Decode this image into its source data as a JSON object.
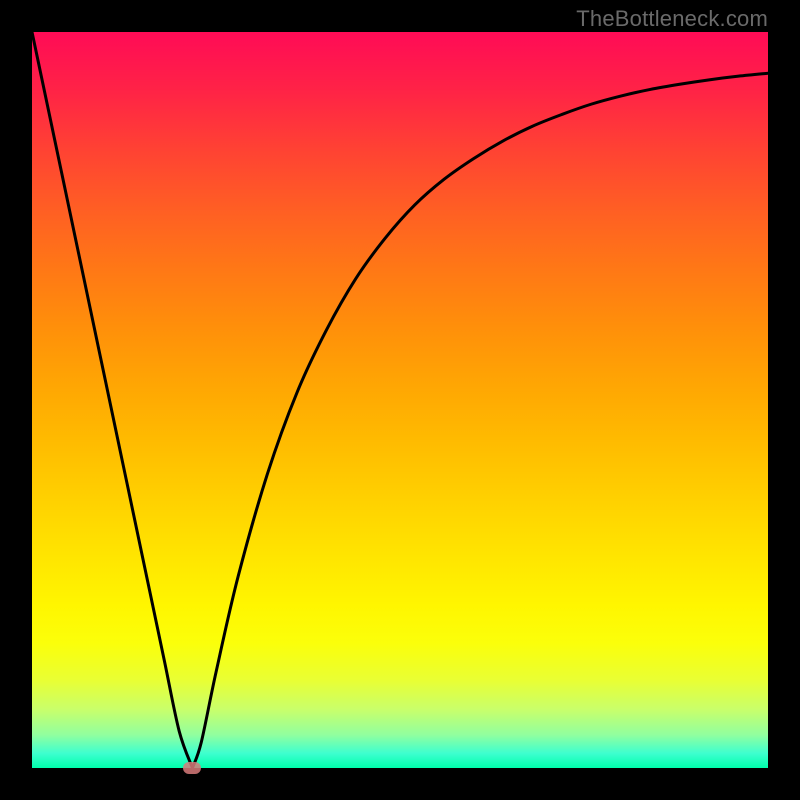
{
  "watermark": "TheBottleneck.com",
  "chart_data": {
    "type": "line",
    "title": "",
    "xlabel": "",
    "ylabel": "",
    "xlim": [
      0,
      1
    ],
    "ylim": [
      0,
      1
    ],
    "grid": false,
    "legend": false,
    "series": [
      {
        "name": "bottleneck-curve",
        "color": "#000000",
        "x": [
          0.0,
          0.02,
          0.04,
          0.06,
          0.08,
          0.1,
          0.12,
          0.14,
          0.16,
          0.18,
          0.2,
          0.218,
          0.23,
          0.25,
          0.28,
          0.32,
          0.36,
          0.4,
          0.44,
          0.48,
          0.52,
          0.56,
          0.6,
          0.64,
          0.68,
          0.72,
          0.76,
          0.8,
          0.84,
          0.88,
          0.92,
          0.96,
          1.0
        ],
        "y": [
          1.0,
          0.905,
          0.81,
          0.715,
          0.62,
          0.525,
          0.43,
          0.335,
          0.24,
          0.145,
          0.05,
          0.0,
          0.035,
          0.13,
          0.26,
          0.4,
          0.51,
          0.595,
          0.665,
          0.72,
          0.765,
          0.8,
          0.828,
          0.852,
          0.872,
          0.888,
          0.902,
          0.913,
          0.922,
          0.929,
          0.935,
          0.94,
          0.944
        ]
      }
    ],
    "marker": {
      "x": 0.218,
      "y": 0.0,
      "color": "#d77a7a",
      "shape": "pill"
    }
  }
}
